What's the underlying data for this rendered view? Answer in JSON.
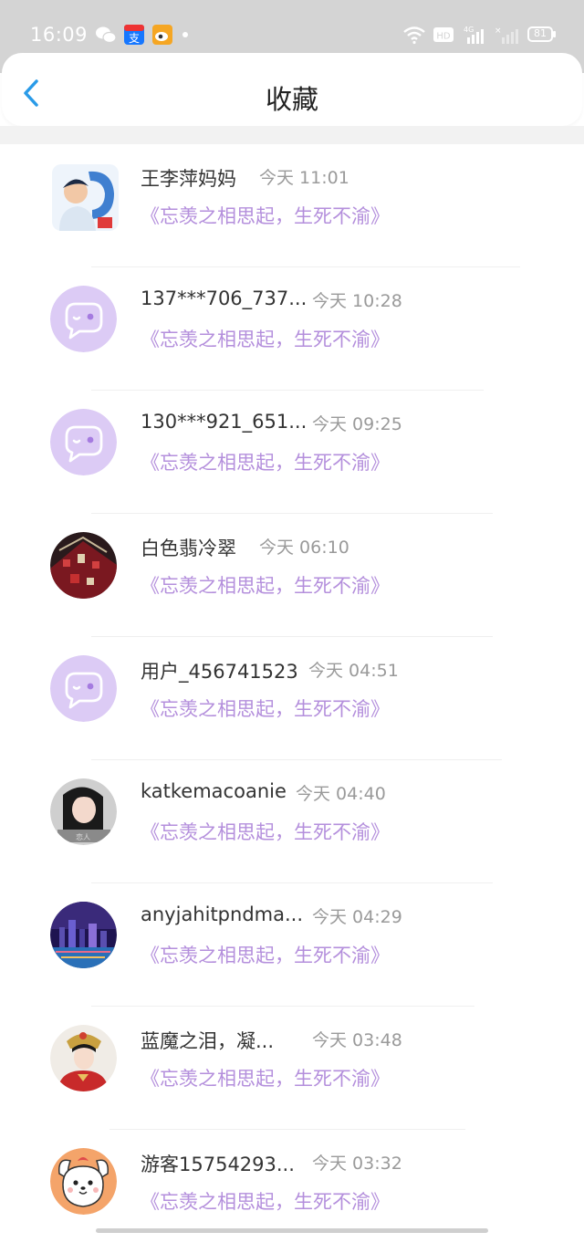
{
  "status_bar": {
    "time": "16:09",
    "battery": "81",
    "network": "4G"
  },
  "header": {
    "title": "收藏"
  },
  "items": [
    {
      "name": "王李萍妈妈",
      "time": "今天 11:01",
      "content": "《忘羡之相思起，生死不渝》",
      "avatar": "photo-child"
    },
    {
      "name": "137***706_737...",
      "time": "今天 10:28",
      "content": "《忘羡之相思起，生死不渝》",
      "avatar": "default-chat"
    },
    {
      "name": "130***921_651...",
      "time": "今天 09:25",
      "content": "《忘羡之相思起，生死不渝》",
      "avatar": "default-chat"
    },
    {
      "name": "白色翡冷翠",
      "time": "今天 06:10",
      "content": "《忘羡之相思起，生死不渝》",
      "avatar": "photo-red"
    },
    {
      "name": "用户_456741523",
      "time": "今天 04:51",
      "content": "《忘羡之相思起，生死不渝》",
      "avatar": "default-chat"
    },
    {
      "name": "katkemacoanie",
      "time": "今天 04:40",
      "content": "《忘羡之相思起，生死不渝》",
      "avatar": "photo-girl"
    },
    {
      "name": "anyjahitpndma...",
      "time": "今天 04:29",
      "content": "《忘羡之相思起，生死不渝》",
      "avatar": "photo-city"
    },
    {
      "name": "蓝魔之泪，凝...",
      "time": "今天 03:48",
      "content": "《忘羡之相思起，生死不渝》",
      "avatar": "photo-costume"
    },
    {
      "name": "游客15754293...",
      "time": "今天 03:32",
      "content": "《忘羡之相思起，生死不渝》",
      "avatar": "cartoon-dog"
    }
  ]
}
